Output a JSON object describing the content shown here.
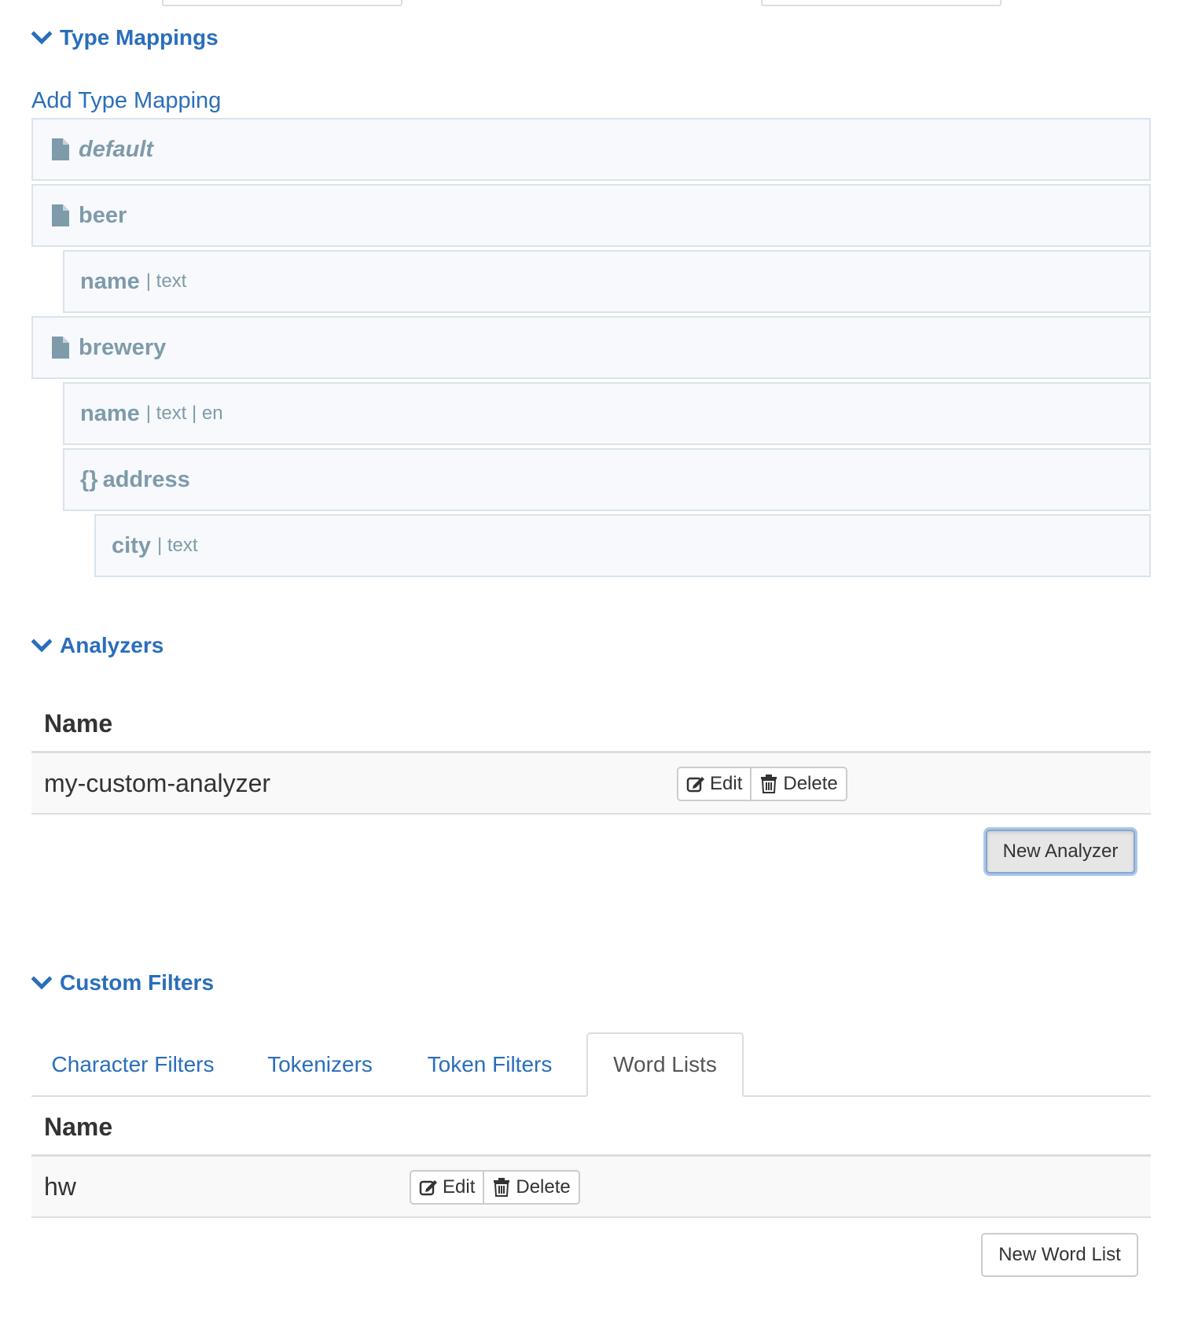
{
  "type_mappings": {
    "header": "Type Mappings",
    "add_link": "Add Type Mapping",
    "rows": [
      {
        "name": "default",
        "meta": ""
      },
      {
        "name": "beer",
        "meta": ""
      },
      {
        "name": "name",
        "meta": "| text"
      },
      {
        "name": "brewery",
        "meta": ""
      },
      {
        "name": "name",
        "meta": "| text | en"
      },
      {
        "brace": "{}",
        "name": "address",
        "meta": ""
      },
      {
        "name": "city",
        "meta": "| text"
      }
    ]
  },
  "analyzers": {
    "header": "Analyzers",
    "column_name": "Name",
    "rows": [
      {
        "name": "my-custom-analyzer",
        "edit_label": "Edit",
        "delete_label": "Delete"
      }
    ],
    "new_button": "New Analyzer"
  },
  "custom_filters": {
    "header": "Custom Filters",
    "tabs": [
      {
        "label": "Character Filters"
      },
      {
        "label": "Tokenizers"
      },
      {
        "label": "Token Filters"
      },
      {
        "label": "Word Lists"
      }
    ],
    "active_tab": "Word Lists",
    "column_name": "Name",
    "rows": [
      {
        "name": "hw",
        "edit_label": "Edit",
        "delete_label": "Delete"
      }
    ],
    "new_button": "New Word List"
  },
  "colors": {
    "link": "#2a6ebb",
    "mapping_text": "#7e9baa",
    "mapping_bg": "#f7f9fc",
    "mapping_border": "#d9e4ec"
  },
  "icons": {
    "section_toggle": "chevron-down-icon",
    "document": "file-icon",
    "edit": "edit-icon",
    "delete": "trash-icon"
  }
}
